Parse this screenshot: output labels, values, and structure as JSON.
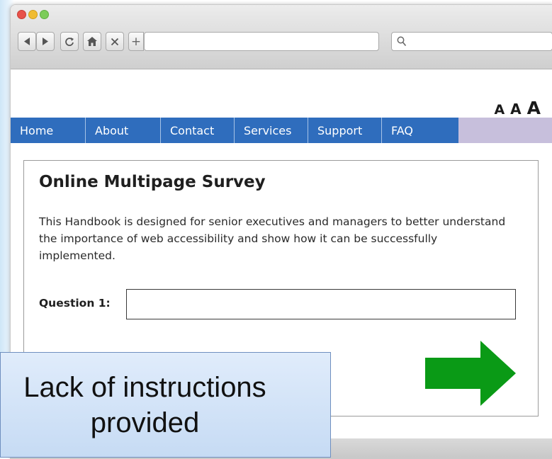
{
  "toolbar": {
    "new_tab_glyph": "+",
    "search_icon": "magnifier-icon"
  },
  "page": {
    "text_size": {
      "small": "A",
      "medium": "A",
      "large": "A"
    },
    "menu": [
      {
        "label": "Home"
      },
      {
        "label": "About"
      },
      {
        "label": "Contact"
      },
      {
        "label": "Services"
      },
      {
        "label": "Support"
      },
      {
        "label": "FAQ"
      }
    ],
    "survey": {
      "title": "Online Multipage Survey",
      "description": "This Handbook is designed for senior executives and managers to better understand the importance of web accessibility and show how it can be successfully implemented.",
      "question_label": "Question 1:",
      "question_value": ""
    }
  },
  "callout": {
    "text": "Lack of instructions\nprovided"
  },
  "colors": {
    "menu_blue": "#2f6dbd",
    "menu_bar_lavender": "#c7bfdc",
    "arrow_green": "#0a9a16",
    "callout_blue": "#c6dbf4"
  }
}
